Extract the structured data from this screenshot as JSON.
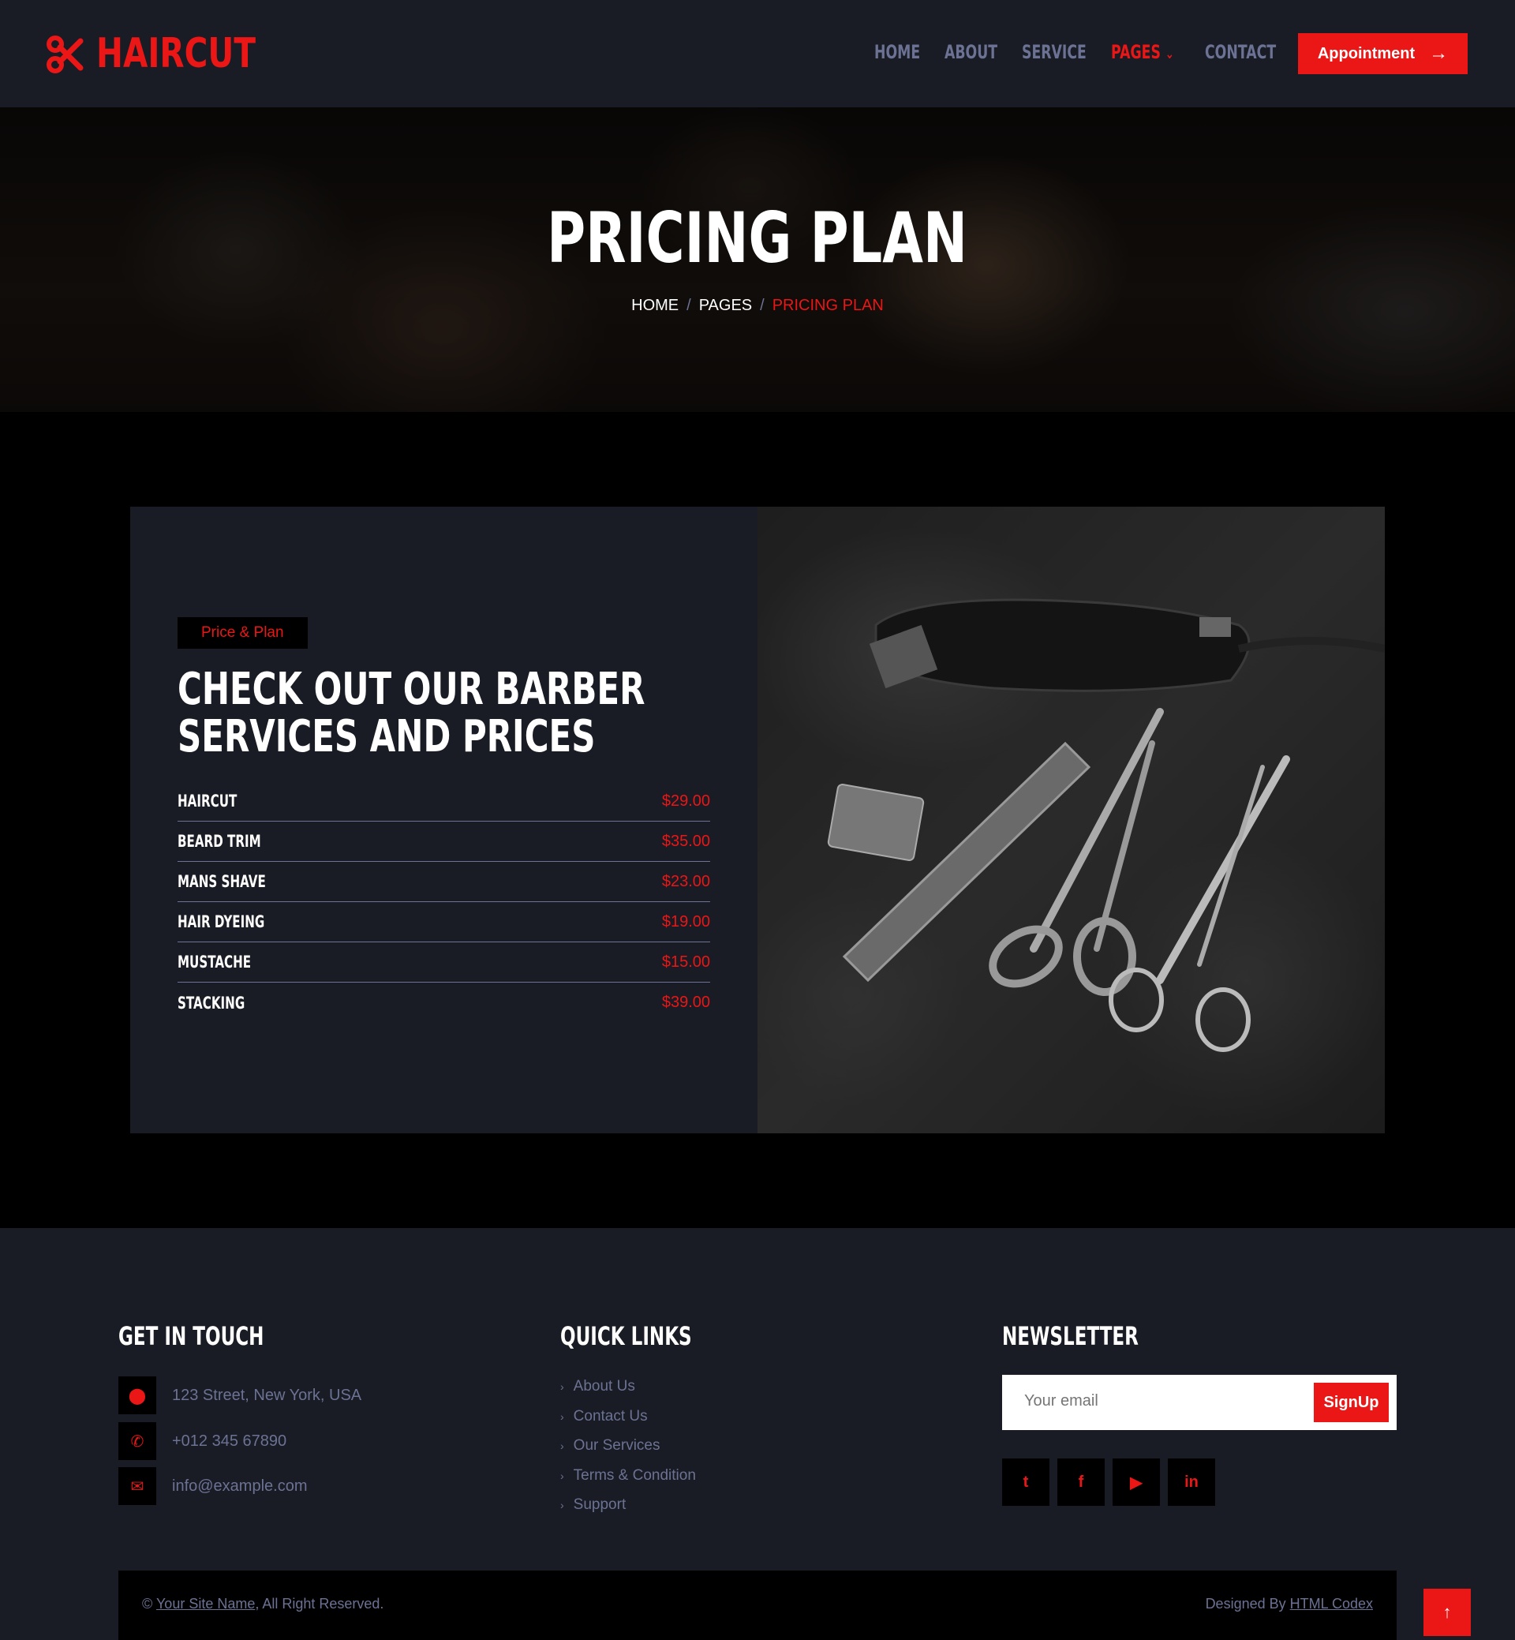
{
  "brand": {
    "name": "HAIRCUT",
    "icon": "scissors-icon",
    "accent": "#eb1616"
  },
  "nav": {
    "items": [
      {
        "label": "HOME"
      },
      {
        "label": "ABOUT"
      },
      {
        "label": "SERVICE"
      },
      {
        "label": "PAGES",
        "active": true
      },
      {
        "label": "CONTACT"
      }
    ],
    "cta": "Appointment"
  },
  "hero": {
    "title": "PRICING PLAN",
    "breadcrumb": [
      "HOME",
      "PAGES",
      "PRICING PLAN"
    ]
  },
  "pricing": {
    "tag": "Price & Plan",
    "title_line1": "CHECK OUT OUR BARBER",
    "title_line2": "SERVICES AND PRICES",
    "items": [
      {
        "name": "HAIRCUT",
        "price": "$29.00"
      },
      {
        "name": "BEARD TRIM",
        "price": "$35.00"
      },
      {
        "name": "MANS SHAVE",
        "price": "$23.00"
      },
      {
        "name": "HAIR DYEING",
        "price": "$19.00"
      },
      {
        "name": "MUSTACHE",
        "price": "$15.00"
      },
      {
        "name": "STACKING",
        "price": "$39.00"
      }
    ]
  },
  "footer": {
    "contact": {
      "heading": "GET IN TOUCH",
      "address": "123 Street, New York, USA",
      "phone": "+012 345 67890",
      "email": "info@example.com"
    },
    "quick_links": {
      "heading": "QUICK LINKS",
      "items": [
        "About Us",
        "Contact Us",
        "Our Services",
        "Terms & Condition",
        "Support"
      ]
    },
    "newsletter": {
      "heading": "NEWSLETTER",
      "placeholder": "Your email",
      "button": "SignUp"
    },
    "social": [
      "twitter-icon",
      "facebook-icon",
      "youtube-icon",
      "linkedin-icon"
    ],
    "copyright": {
      "prefix": "© ",
      "site_name": "Your Site Name",
      "suffix": ", All Right Reserved.",
      "designed_by": "Designed By ",
      "designer": "HTML Codex"
    },
    "back_to_top": "↑"
  }
}
